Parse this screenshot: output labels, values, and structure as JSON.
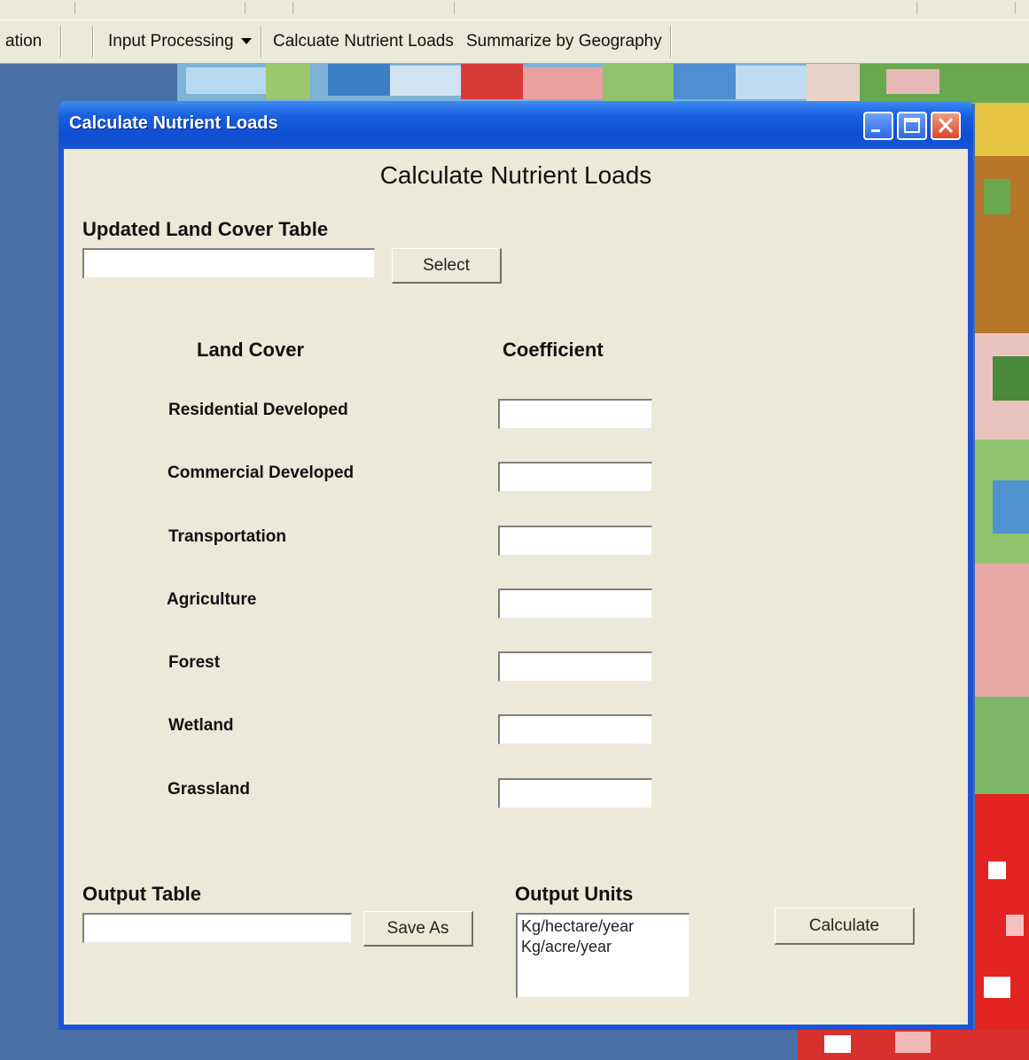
{
  "toolbar": {
    "items": [
      "ation",
      "Input Processing",
      "Calcuate Nutrient Loads",
      "Summarize by Geography"
    ]
  },
  "dialog": {
    "title": "Calculate Nutrient Loads",
    "heading": "Calculate Nutrient Loads",
    "land_cover_table_label": "Updated Land Cover Table",
    "land_cover_table_value": "",
    "select_button": "Select",
    "col_land_cover": "Land Cover",
    "col_coefficient": "Coefficient",
    "rows": [
      {
        "label": "Residential Developed",
        "value": ""
      },
      {
        "label": "Commercial Developed",
        "value": ""
      },
      {
        "label": "Transportation",
        "value": ""
      },
      {
        "label": "Agriculture",
        "value": ""
      },
      {
        "label": "Forest",
        "value": ""
      },
      {
        "label": "Wetland",
        "value": ""
      },
      {
        "label": "Grassland",
        "value": ""
      }
    ],
    "output_table_label": "Output Table",
    "output_table_value": "",
    "save_as_button": "Save As",
    "output_units_label": "Output Units",
    "units_options": [
      "Kg/hectare/year",
      "Kg/acre/year"
    ],
    "calculate_button": "Calculate"
  },
  "colors": {
    "title_bar": "#0f4fd1",
    "dialog_face": "#ece9d8",
    "map_background": "#4a6fa6"
  },
  "icons": [
    "minimize-icon",
    "maximize-icon",
    "close-icon",
    "dropdown-caret-icon"
  ]
}
